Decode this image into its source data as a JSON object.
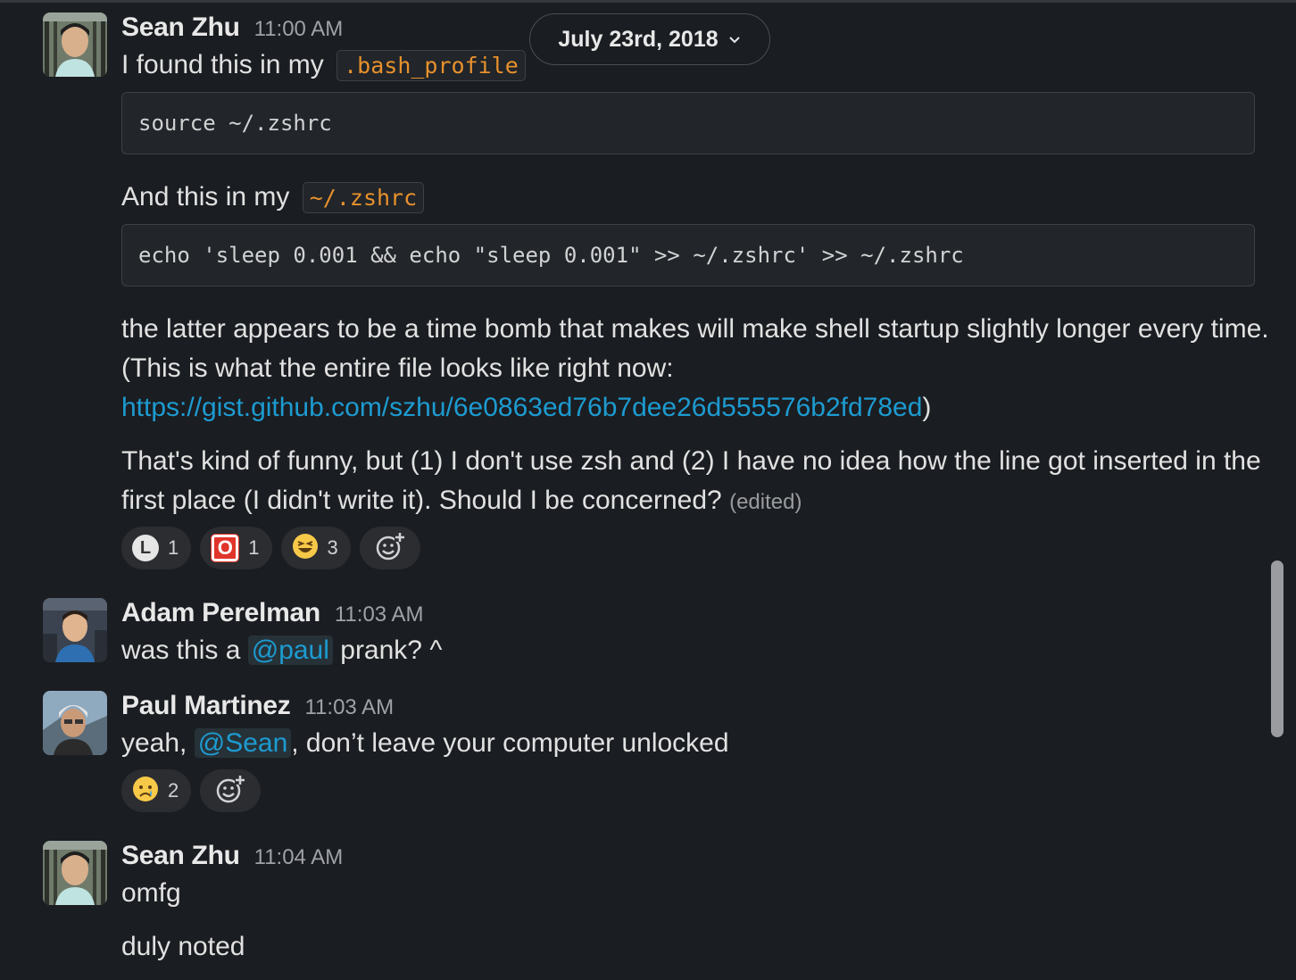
{
  "date_divider": {
    "label": "July 23rd, 2018",
    "icon": "chevron-down-icon"
  },
  "messages": [
    {
      "sender": "Sean Zhu",
      "time": "11:00 AM",
      "intro_1": "I found this in my ",
      "code_1": ".bash_profile",
      "block_1": "source ~/.zshrc",
      "intro_2": "And this in my ",
      "code_2": "~/.zshrc",
      "block_2": "echo 'sleep 0.001 && echo \"sleep 0.001\" >> ~/.zshrc' >> ~/.zshrc",
      "para_1": "the latter appears to be a time bomb that makes will make shell startup slightly longer every time.",
      "para_2": "(This is what the entire file looks like right now:",
      "link": "https://gist.github.com/szhu/6e0863ed76b7dee26d555576b2fd78ed",
      "link_tail": ")",
      "para_3": "That's kind of funny, but (1) I don't use zsh and (2) I have no idea how the line got inserted in the",
      "para_4": "first place (I didn't write it). Should I be concerned? ",
      "edited": "(edited)",
      "reactions": [
        {
          "emoji": "L-badge",
          "symbol": "L",
          "count": "1"
        },
        {
          "emoji": "O-badge",
          "symbol": "O",
          "count": "1"
        },
        {
          "emoji": "laughing-face",
          "count": "3"
        }
      ]
    },
    {
      "sender": "Adam Perelman",
      "time": "11:03 AM",
      "text_before": "was this a ",
      "mention": "@paul",
      "text_after": " prank? ^"
    },
    {
      "sender": "Paul Martinez",
      "time": "11:03 AM",
      "text_before": "yeah, ",
      "mention": "@Sean",
      "text_after": ", don’t leave your computer unlocked",
      "reactions": [
        {
          "emoji": "crying-face",
          "count": "2"
        }
      ]
    },
    {
      "sender": "Sean Zhu",
      "time": "11:04 AM",
      "line_1": "omfg",
      "line_2": "duly noted"
    }
  ],
  "colors": {
    "background": "#1a1d21",
    "link": "#1d9bd1",
    "inline_code": "#e8912d"
  }
}
